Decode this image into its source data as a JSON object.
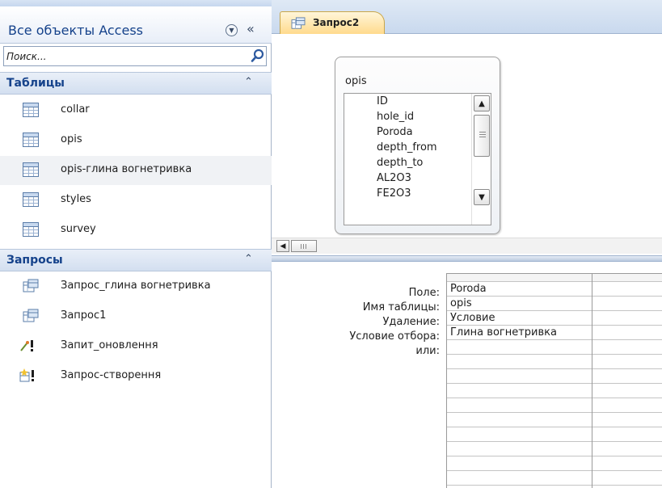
{
  "nav": {
    "title": "Все объекты Access",
    "search": {
      "placeholder": "Поиск..."
    },
    "groups": [
      {
        "label": "Таблицы",
        "items": [
          {
            "label": "collar",
            "icon": "table-icon"
          },
          {
            "label": "opis",
            "icon": "table-icon"
          },
          {
            "label": "opis-глина вогнетривка",
            "icon": "table-icon"
          },
          {
            "label": "styles",
            "icon": "table-icon"
          },
          {
            "label": "survey",
            "icon": "table-icon"
          }
        ]
      },
      {
        "label": "Запросы",
        "items": [
          {
            "label": "Запрос_глина вогнетривка",
            "icon": "select-query-icon"
          },
          {
            "label": "Запрос1",
            "icon": "select-query-icon"
          },
          {
            "label": "Запит_оновлення",
            "icon": "update-query-icon"
          },
          {
            "label": "Запрос-створення",
            "icon": "make-table-query-icon"
          }
        ]
      }
    ]
  },
  "document": {
    "tab_label": "Запрос2",
    "field_list": {
      "title": "opis",
      "fields": [
        "ID",
        "hole_id",
        "Poroda",
        "depth_from",
        "depth_to",
        "AL2O3",
        "FE2O3"
      ]
    },
    "qbe": {
      "row_labels": [
        "Поле:",
        "Имя таблицы:",
        "Удаление:",
        "Условие отбора:",
        "или:"
      ],
      "column1": [
        "Poroda",
        "opis",
        "Условие",
        "Глина вогнетривка",
        ""
      ]
    }
  },
  "colors": {
    "nav_title": "#15428b",
    "tab_active": "#ffd98a",
    "group_header": "#d3dff0"
  }
}
